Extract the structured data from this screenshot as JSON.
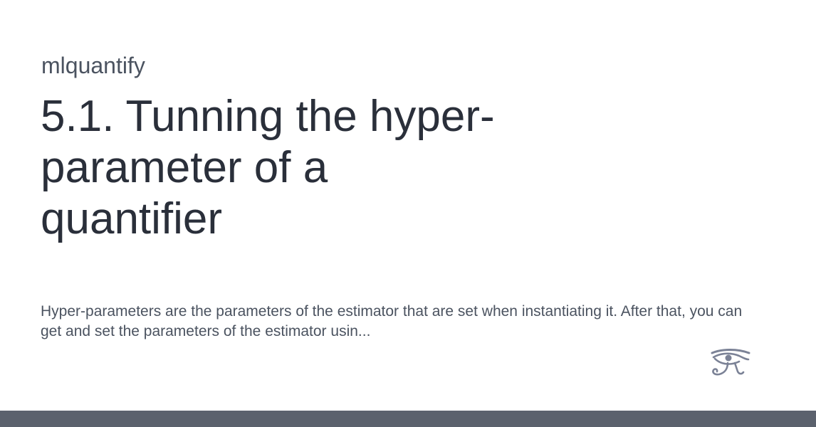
{
  "site": {
    "name": "mlquantify"
  },
  "page": {
    "title": "5.1. Tunning the hyper-parameter of a quantifier",
    "description": "Hyper-parameters are the parameters of the estimator that are set when instantiating it. After that, you can get and set the parameters of the estimator usin..."
  },
  "logo": {
    "icon": "eye-of-horus-icon",
    "color": "#7b8296"
  },
  "footer": {
    "color": "#5b616d"
  }
}
